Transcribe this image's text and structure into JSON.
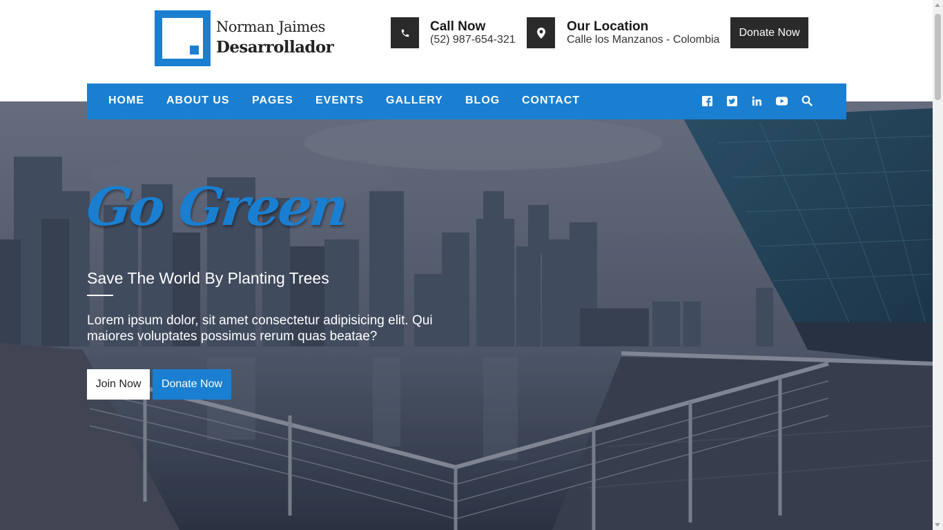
{
  "brand": {
    "name": "Norman Jaimes",
    "subtitle": "Desarrollador",
    "accent_color": "#1a7fd0"
  },
  "header": {
    "call": {
      "icon": "phone-icon",
      "title": "Call Now",
      "text": "(52) 987-654-321"
    },
    "location": {
      "icon": "map-marker-icon",
      "title": "Our Location",
      "text": "Calle los Manzanos - Colombia"
    },
    "donate_label": "Donate Now"
  },
  "nav": {
    "items": [
      "HOME",
      "ABOUT US",
      "PAGES",
      "EVENTS",
      "GALLERY",
      "BLOG",
      "CONTACT"
    ],
    "icons": [
      "facebook-icon",
      "twitter-icon",
      "linkedin-icon",
      "youtube-icon",
      "search-icon"
    ]
  },
  "hero": {
    "title": "Go Green",
    "subtitle": "Save The World By Planting Trees",
    "text": "Lorem ipsum dolor, sit amet consectetur adipisicing elit. Qui maiores voluptates possimus rerum quas beatae?",
    "join_label": "Join Now",
    "donate_label": "Donate Now"
  }
}
